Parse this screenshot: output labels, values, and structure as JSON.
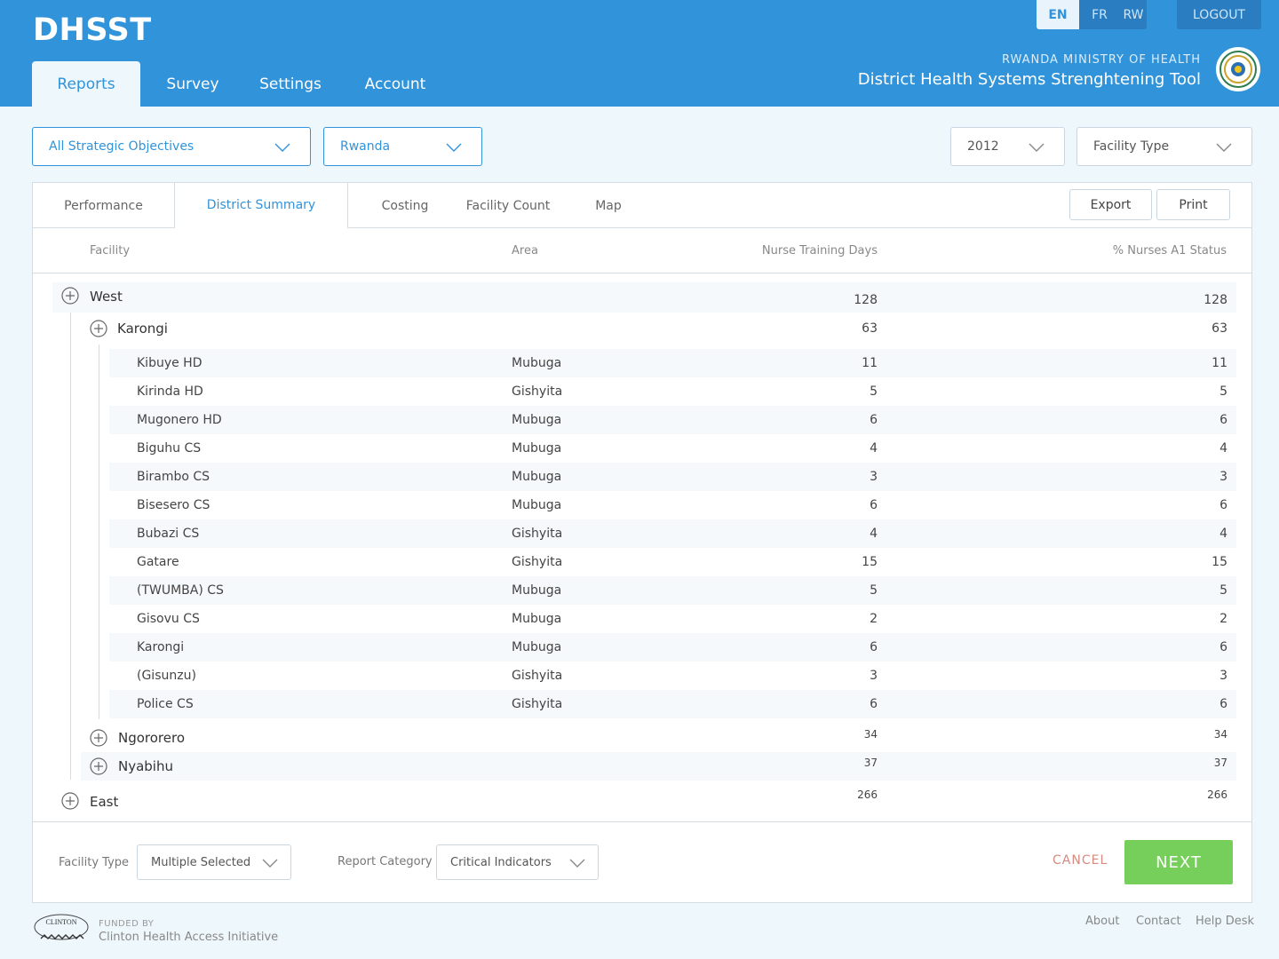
{
  "app": {
    "title": "DHSST"
  },
  "nav": {
    "tabs": [
      "Reports",
      "Survey",
      "Settings",
      "Account"
    ]
  },
  "languages": [
    "EN",
    "FR",
    "RW"
  ],
  "logout_label": "LOGOUT",
  "ministry": {
    "org": "RWANDA MINISTRY OF HEALTH",
    "tool": "District Health Systems Strenghtening Tool"
  },
  "filters": {
    "objectives": "All Strategic Objectives",
    "country": "Rwanda",
    "year": "2012",
    "facility_type": "Facility Type"
  },
  "report_tabs": [
    "Performance",
    "District Summary",
    "Costing",
    "Facility Count",
    "Map"
  ],
  "actions": {
    "export": "Export",
    "print": "Print"
  },
  "columns": {
    "facility": "Facility",
    "area": "Area",
    "nurse_days": "Nurse Training Days",
    "nurses_a1": "% Nurses A1 Status"
  },
  "table": {
    "west": {
      "name": "West",
      "days": "128",
      "pct": "128"
    },
    "karongi": {
      "name": "Karongi",
      "days": "63",
      "pct": "63"
    },
    "facilities": [
      {
        "name": "Kibuye HD",
        "area": "Mubuga",
        "days": "11",
        "pct": "11"
      },
      {
        "name": "Kirinda HD",
        "area": "Gishyita",
        "days": "5",
        "pct": "5"
      },
      {
        "name": "Mugonero HD",
        "area": "Mubuga",
        "days": "6",
        "pct": "6"
      },
      {
        "name": "Biguhu CS",
        "area": "Mubuga",
        "days": "4",
        "pct": "4"
      },
      {
        "name": "Birambo CS",
        "area": "Mubuga",
        "days": "3",
        "pct": "3"
      },
      {
        "name": "Bisesero CS",
        "area": "Mubuga",
        "days": "6",
        "pct": "6"
      },
      {
        "name": "Bubazi CS",
        "area": "Gishyita",
        "days": "4",
        "pct": "4"
      },
      {
        "name": "Gatare",
        "area": "Gishyita",
        "days": "15",
        "pct": "15"
      },
      {
        "name": "(TWUMBA) CS",
        "area": "Mubuga",
        "days": "5",
        "pct": "5"
      },
      {
        "name": "Gisovu CS",
        "area": "Mubuga",
        "days": "2",
        "pct": "2"
      },
      {
        "name": "Karongi",
        "area": "Mubuga",
        "days": "6",
        "pct": "6"
      },
      {
        "name": "(Gisunzu)",
        "area": "Gishyita",
        "days": "3",
        "pct": "3"
      },
      {
        "name": "Police CS",
        "area": "Gishyita",
        "days": "6",
        "pct": "6"
      }
    ],
    "ngororero": {
      "name": "Ngororero",
      "days": "34",
      "pct": "34"
    },
    "nyabihu": {
      "name": "Nyabihu",
      "days": "37",
      "pct": "37"
    },
    "east": {
      "name": "East",
      "days": "266",
      "pct": "266"
    }
  },
  "footer_filters": {
    "facility_type_label": "Facility Type",
    "facility_type_value": "Multiple Selected",
    "report_category_label": "Report Category",
    "report_category_value": "Critical Indicators"
  },
  "buttons": {
    "cancel": "CANCEL",
    "next": "NEXT"
  },
  "funder": {
    "prefix": "FUNDED BY",
    "name": "Clinton Health Access Initiative",
    "logo_text": "CLINTON"
  },
  "footer_links": [
    "About",
    "Contact",
    "Help Desk"
  ],
  "colors": {
    "primary": "#3193d9",
    "next": "#76cf5a",
    "cancel": "#d68a80"
  }
}
